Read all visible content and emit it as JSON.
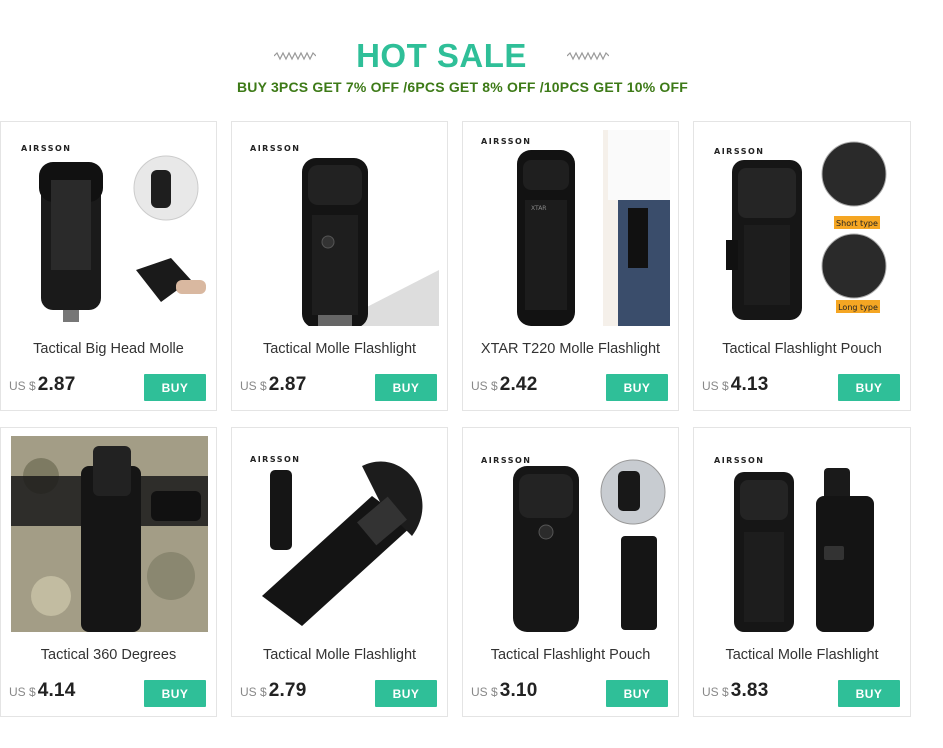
{
  "header": {
    "title": "HOT SALE",
    "subtitle": "BUY 3PCS GET 7% OFF /6PCS GET 8% OFF /10PCS GET 10% OFF"
  },
  "brand_logo": "AIRSSON",
  "colors": {
    "accent": "#2fbf98",
    "subtitle": "#3d7a17"
  },
  "products": [
    {
      "name": "Tactical Big Head Molle",
      "currency": "US $",
      "price": "2.87",
      "buy_label": "BUY"
    },
    {
      "name": "Tactical Molle Flashlight",
      "currency": "US $",
      "price": "2.87",
      "buy_label": "BUY"
    },
    {
      "name": "XTAR T220 Molle Flashlight",
      "currency": "US $",
      "price": "2.42",
      "buy_label": "BUY"
    },
    {
      "name": "Tactical Flashlight Pouch",
      "currency": "US $",
      "price": "4.13",
      "buy_label": "BUY"
    },
    {
      "name": "Tactical 360 Degrees",
      "currency": "US $",
      "price": "4.14",
      "buy_label": "BUY"
    },
    {
      "name": "Tactical Molle Flashlight",
      "currency": "US $",
      "price": "2.79",
      "buy_label": "BUY"
    },
    {
      "name": "Tactical Flashlight Pouch",
      "currency": "US $",
      "price": "3.10",
      "buy_label": "BUY"
    },
    {
      "name": "Tactical Molle Flashlight",
      "currency": "US $",
      "price": "3.83",
      "buy_label": "BUY"
    }
  ],
  "image_labels": {
    "short_type": "Short type",
    "long_type": "Long type"
  }
}
